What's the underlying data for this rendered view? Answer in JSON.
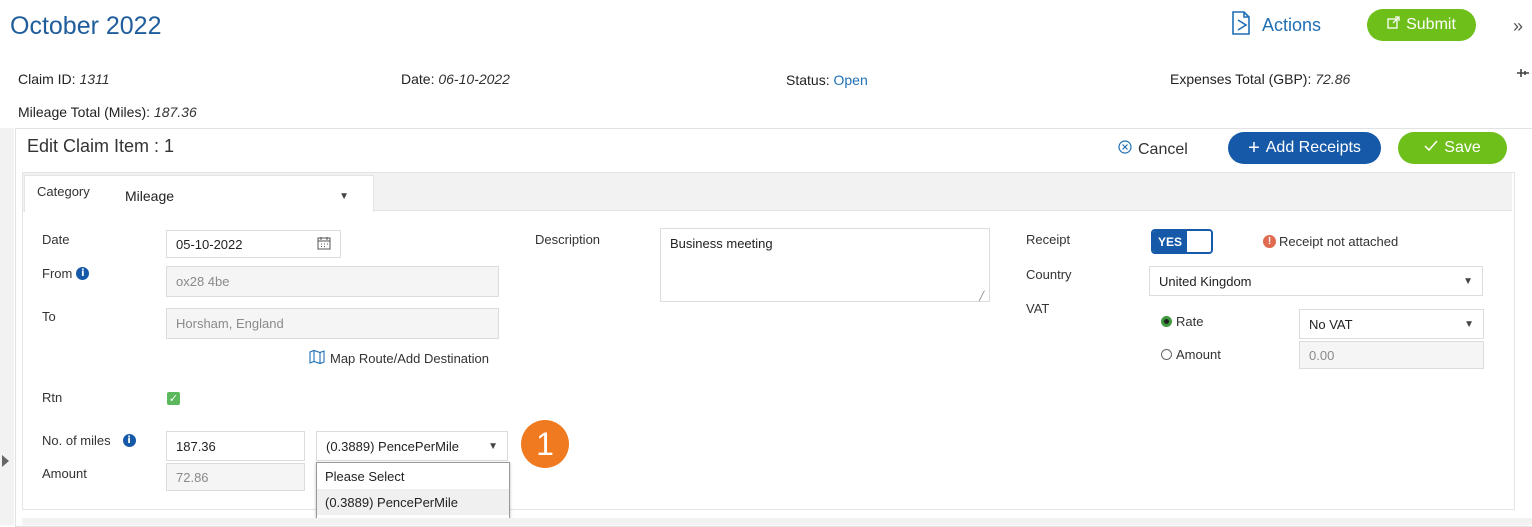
{
  "header": {
    "title": "October 2022",
    "actions_label": "Actions",
    "submit_label": "Submit",
    "expand_label": "»"
  },
  "summary": {
    "claim_id_label": "Claim ID:",
    "claim_id_value": "1311",
    "date_label": "Date:",
    "date_value": "06-10-2022",
    "status_label": "Status:",
    "status_value": "Open",
    "expenses_total_label": "Expenses Total (GBP):",
    "expenses_total_value": "72.86",
    "mileage_total_label": "Mileage Total (Miles):",
    "mileage_total_value": "187.36"
  },
  "edit_item": {
    "title": "Edit Claim Item : 1",
    "cancel_label": "Cancel",
    "add_receipts_label": "Add Receipts",
    "save_label": "Save"
  },
  "form": {
    "category_label": "Category",
    "category_value": "Mileage",
    "date_label": "Date",
    "date_value": "05-10-2022",
    "from_label": "From",
    "from_value": "ox28 4be",
    "to_label": "To",
    "to_value": "Horsham, England",
    "map_route_label": "Map Route/Add Destination",
    "rtn_label": "Rtn",
    "miles_label": "No. of miles",
    "miles_value": "187.36",
    "rate_value": "(0.3889) PencePerMile",
    "amount_label": "Amount",
    "amount_value": "72.86",
    "rate_options": [
      "Please Select",
      "(0.3889) PencePerMile"
    ],
    "description_label": "Description",
    "description_value": "Business meeting",
    "receipt_label": "Receipt",
    "receipt_toggle": "YES",
    "receipt_warning": "Receipt not attached",
    "country_label": "Country",
    "country_value": "United Kingdom",
    "vat_label": "VAT",
    "vat_rate_label": "Rate",
    "vat_rate_value": "No VAT",
    "vat_amount_label": "Amount",
    "vat_amount_value": "0.00"
  },
  "annotation": {
    "step_number": "1"
  },
  "colors": {
    "brand_blue": "#1559a8",
    "green": "#6fbf1a",
    "orange": "#f07a20",
    "title_blue": "#1f5d9b"
  }
}
